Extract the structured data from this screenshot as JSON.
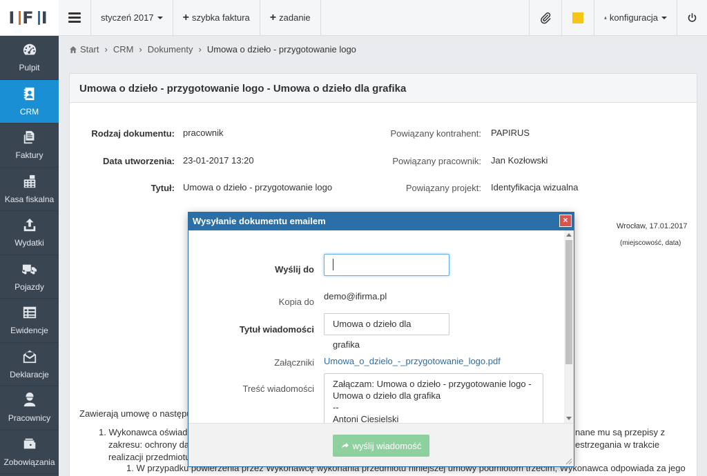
{
  "logo": "IFI",
  "sidebar": {
    "items": [
      {
        "label": "Pulpit",
        "icon": "dashboard-icon",
        "active": false
      },
      {
        "label": "CRM",
        "icon": "contacts-icon",
        "active": true
      },
      {
        "label": "Faktury",
        "icon": "invoice-icon",
        "active": false
      },
      {
        "label": "Kasa fiskalna",
        "icon": "calculator-icon",
        "active": false
      },
      {
        "label": "Wydatki",
        "icon": "upload-icon",
        "active": false
      },
      {
        "label": "Pojazdy",
        "icon": "truck-icon",
        "active": false
      },
      {
        "label": "Ewidencje",
        "icon": "table-icon",
        "active": false
      },
      {
        "label": "Deklaracje",
        "icon": "envelope-icon",
        "active": false
      },
      {
        "label": "Pracownicy",
        "icon": "worker-icon",
        "active": false
      },
      {
        "label": "Zobowiązania",
        "icon": "wallet-icon",
        "active": false
      }
    ]
  },
  "topbar": {
    "period": "styczeń 2017",
    "quick_invoice": "szybka faktura",
    "task": "zadanie",
    "config": "konfiguracja"
  },
  "breadcrumb": [
    "Start",
    "CRM",
    "Dokumenty",
    "Umowa o dzieło - przygotowanie logo"
  ],
  "panel": {
    "title": "Umowa o dzieło - przygotowanie logo - Umowa o dzieło dla grafika",
    "fields_left": [
      {
        "label": "Rodzaj dokumentu:",
        "value": "pracownik"
      },
      {
        "label": "Data utworzenia:",
        "value": "23-01-2017 13:20"
      },
      {
        "label": "Tytuł:",
        "value": "Umowa o dzieło - przygotowanie logo"
      }
    ],
    "fields_right": [
      {
        "label": "Powiązany kontrahent:",
        "value": "PAPIRUS"
      },
      {
        "label": "Powiązany pracownik:",
        "value": "Jan Kozłowski"
      },
      {
        "label": "Powiązany projekt:",
        "value": "Identyfikacja wizualna"
      }
    ],
    "doc_place_date": "Wrocław, 17.01.2017",
    "doc_place_date_caption": "(miejscowość, data)",
    "doc_line1": "Zawierają umowę o następu",
    "doc_line2": "1. Wykonawca oświadc",
    "doc_line2_right": "nane mu są przepisy z",
    "doc_line3": "zakresu: ochrony da",
    "doc_line3_right": "estrzegania w trakcie",
    "doc_line4": "realizacji przedmiotu",
    "doc_line5": "1. W przypadku powierzenia przez Wykonawcę wykonania przedmiotu niniejszej umowy podmiotom trzecim, Wykonawca odpowiada za jego"
  },
  "modal": {
    "title": "Wysyłanie dokumentu emailem",
    "close": "×",
    "to_label": "Wyślij do",
    "to_value": "",
    "cc_label": "Kopia do",
    "cc_value": "demo@ifirma.pl",
    "subject_label": "Tytuł wiadomości",
    "subject_value": "Umowa o dzieło dla grafika",
    "attach_label": "Załączniki",
    "attach_value": "Umowa_o_dzielo_-_przygotowanie_logo.pdf",
    "body_label": "Treść wiadomości",
    "body_line1": "Załączam: Umowa o dzieło - przygotowanie logo -",
    "body_line2": "Umowa o dzieło dla grafika",
    "body_line3": "--",
    "body_line4": "Antoni Ciesielski",
    "send_label": "wyślij wiadomość",
    "send_color": "#8fd19e"
  }
}
